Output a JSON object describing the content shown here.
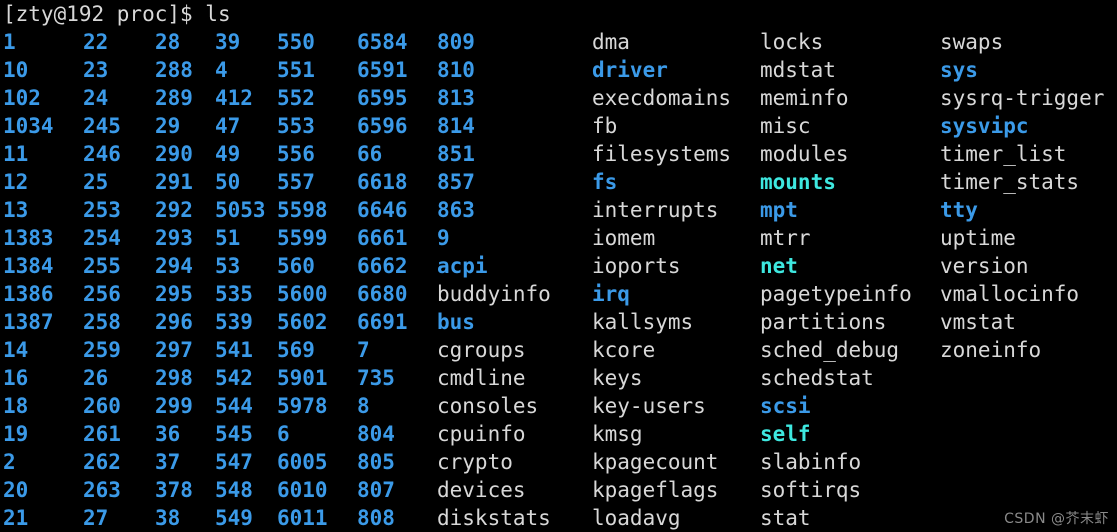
{
  "terminal": {
    "prompt": "[zty@192 proc]$ ",
    "command": "ls",
    "colors": {
      "background": "#000000",
      "file": "#d8d8d8",
      "directory": "#3b9ae8",
      "symlink": "#3ee8e0"
    }
  },
  "watermark": "CSDN @芥末虾",
  "listing": {
    "columns": [
      {
        "index": 0,
        "entries": [
          {
            "name": "1",
            "type": "dir"
          },
          {
            "name": "10",
            "type": "dir"
          },
          {
            "name": "102",
            "type": "dir"
          },
          {
            "name": "1034",
            "type": "dir"
          },
          {
            "name": "11",
            "type": "dir"
          },
          {
            "name": "12",
            "type": "dir"
          },
          {
            "name": "13",
            "type": "dir"
          },
          {
            "name": "1383",
            "type": "dir"
          },
          {
            "name": "1384",
            "type": "dir"
          },
          {
            "name": "1386",
            "type": "dir"
          },
          {
            "name": "1387",
            "type": "dir"
          },
          {
            "name": "14",
            "type": "dir"
          },
          {
            "name": "16",
            "type": "dir"
          },
          {
            "name": "18",
            "type": "dir"
          },
          {
            "name": "19",
            "type": "dir"
          },
          {
            "name": "2",
            "type": "dir"
          },
          {
            "name": "20",
            "type": "dir"
          },
          {
            "name": "21",
            "type": "dir"
          }
        ]
      },
      {
        "index": 1,
        "entries": [
          {
            "name": "22",
            "type": "dir"
          },
          {
            "name": "23",
            "type": "dir"
          },
          {
            "name": "24",
            "type": "dir"
          },
          {
            "name": "245",
            "type": "dir"
          },
          {
            "name": "246",
            "type": "dir"
          },
          {
            "name": "25",
            "type": "dir"
          },
          {
            "name": "253",
            "type": "dir"
          },
          {
            "name": "254",
            "type": "dir"
          },
          {
            "name": "255",
            "type": "dir"
          },
          {
            "name": "256",
            "type": "dir"
          },
          {
            "name": "258",
            "type": "dir"
          },
          {
            "name": "259",
            "type": "dir"
          },
          {
            "name": "26",
            "type": "dir"
          },
          {
            "name": "260",
            "type": "dir"
          },
          {
            "name": "261",
            "type": "dir"
          },
          {
            "name": "262",
            "type": "dir"
          },
          {
            "name": "263",
            "type": "dir"
          },
          {
            "name": "27",
            "type": "dir"
          }
        ]
      },
      {
        "index": 2,
        "entries": [
          {
            "name": "28",
            "type": "dir"
          },
          {
            "name": "288",
            "type": "dir"
          },
          {
            "name": "289",
            "type": "dir"
          },
          {
            "name": "29",
            "type": "dir"
          },
          {
            "name": "290",
            "type": "dir"
          },
          {
            "name": "291",
            "type": "dir"
          },
          {
            "name": "292",
            "type": "dir"
          },
          {
            "name": "293",
            "type": "dir"
          },
          {
            "name": "294",
            "type": "dir"
          },
          {
            "name": "295",
            "type": "dir"
          },
          {
            "name": "296",
            "type": "dir"
          },
          {
            "name": "297",
            "type": "dir"
          },
          {
            "name": "298",
            "type": "dir"
          },
          {
            "name": "299",
            "type": "dir"
          },
          {
            "name": "36",
            "type": "dir"
          },
          {
            "name": "37",
            "type": "dir"
          },
          {
            "name": "378",
            "type": "dir"
          },
          {
            "name": "38",
            "type": "dir"
          }
        ]
      },
      {
        "index": 3,
        "entries": [
          {
            "name": "39",
            "type": "dir"
          },
          {
            "name": "4",
            "type": "dir"
          },
          {
            "name": "412",
            "type": "dir"
          },
          {
            "name": "47",
            "type": "dir"
          },
          {
            "name": "49",
            "type": "dir"
          },
          {
            "name": "50",
            "type": "dir"
          },
          {
            "name": "5053",
            "type": "dir"
          },
          {
            "name": "51",
            "type": "dir"
          },
          {
            "name": "53",
            "type": "dir"
          },
          {
            "name": "535",
            "type": "dir"
          },
          {
            "name": "539",
            "type": "dir"
          },
          {
            "name": "541",
            "type": "dir"
          },
          {
            "name": "542",
            "type": "dir"
          },
          {
            "name": "544",
            "type": "dir"
          },
          {
            "name": "545",
            "type": "dir"
          },
          {
            "name": "547",
            "type": "dir"
          },
          {
            "name": "548",
            "type": "dir"
          },
          {
            "name": "549",
            "type": "dir"
          }
        ]
      },
      {
        "index": 4,
        "entries": [
          {
            "name": "550",
            "type": "dir"
          },
          {
            "name": "551",
            "type": "dir"
          },
          {
            "name": "552",
            "type": "dir"
          },
          {
            "name": "553",
            "type": "dir"
          },
          {
            "name": "556",
            "type": "dir"
          },
          {
            "name": "557",
            "type": "dir"
          },
          {
            "name": "5598",
            "type": "dir"
          },
          {
            "name": "5599",
            "type": "dir"
          },
          {
            "name": "560",
            "type": "dir"
          },
          {
            "name": "5600",
            "type": "dir"
          },
          {
            "name": "5602",
            "type": "dir"
          },
          {
            "name": "569",
            "type": "dir"
          },
          {
            "name": "5901",
            "type": "dir"
          },
          {
            "name": "5978",
            "type": "dir"
          },
          {
            "name": "6",
            "type": "dir"
          },
          {
            "name": "6005",
            "type": "dir"
          },
          {
            "name": "6010",
            "type": "dir"
          },
          {
            "name": "6011",
            "type": "dir"
          }
        ]
      },
      {
        "index": 5,
        "entries": [
          {
            "name": "6584",
            "type": "dir"
          },
          {
            "name": "6591",
            "type": "dir"
          },
          {
            "name": "6595",
            "type": "dir"
          },
          {
            "name": "6596",
            "type": "dir"
          },
          {
            "name": "66",
            "type": "dir"
          },
          {
            "name": "6618",
            "type": "dir"
          },
          {
            "name": "6646",
            "type": "dir"
          },
          {
            "name": "6661",
            "type": "dir"
          },
          {
            "name": "6662",
            "type": "dir"
          },
          {
            "name": "6680",
            "type": "dir"
          },
          {
            "name": "6691",
            "type": "dir"
          },
          {
            "name": "7",
            "type": "dir"
          },
          {
            "name": "735",
            "type": "dir"
          },
          {
            "name": "8",
            "type": "dir"
          },
          {
            "name": "804",
            "type": "dir"
          },
          {
            "name": "805",
            "type": "dir"
          },
          {
            "name": "807",
            "type": "dir"
          },
          {
            "name": "808",
            "type": "dir"
          }
        ]
      },
      {
        "index": 6,
        "entries": [
          {
            "name": "809",
            "type": "dir"
          },
          {
            "name": "810",
            "type": "dir"
          },
          {
            "name": "813",
            "type": "dir"
          },
          {
            "name": "814",
            "type": "dir"
          },
          {
            "name": "851",
            "type": "dir"
          },
          {
            "name": "857",
            "type": "dir"
          },
          {
            "name": "863",
            "type": "dir"
          },
          {
            "name": "9",
            "type": "dir"
          },
          {
            "name": "acpi",
            "type": "dir"
          },
          {
            "name": "buddyinfo",
            "type": "file"
          },
          {
            "name": "bus",
            "type": "dir"
          },
          {
            "name": "cgroups",
            "type": "file"
          },
          {
            "name": "cmdline",
            "type": "file"
          },
          {
            "name": "consoles",
            "type": "file"
          },
          {
            "name": "cpuinfo",
            "type": "file"
          },
          {
            "name": "crypto",
            "type": "file"
          },
          {
            "name": "devices",
            "type": "file"
          },
          {
            "name": "diskstats",
            "type": "file"
          }
        ]
      },
      {
        "index": 7,
        "entries": [
          {
            "name": "dma",
            "type": "file"
          },
          {
            "name": "driver",
            "type": "dir"
          },
          {
            "name": "execdomains",
            "type": "file"
          },
          {
            "name": "fb",
            "type": "file"
          },
          {
            "name": "filesystems",
            "type": "file"
          },
          {
            "name": "fs",
            "type": "dir"
          },
          {
            "name": "interrupts",
            "type": "file"
          },
          {
            "name": "iomem",
            "type": "file"
          },
          {
            "name": "ioports",
            "type": "file"
          },
          {
            "name": "irq",
            "type": "dir"
          },
          {
            "name": "kallsyms",
            "type": "file"
          },
          {
            "name": "kcore",
            "type": "file"
          },
          {
            "name": "keys",
            "type": "file"
          },
          {
            "name": "key-users",
            "type": "file"
          },
          {
            "name": "kmsg",
            "type": "file"
          },
          {
            "name": "kpagecount",
            "type": "file"
          },
          {
            "name": "kpageflags",
            "type": "file"
          },
          {
            "name": "loadavg",
            "type": "file"
          }
        ]
      },
      {
        "index": 8,
        "entries": [
          {
            "name": "locks",
            "type": "file"
          },
          {
            "name": "mdstat",
            "type": "file"
          },
          {
            "name": "meminfo",
            "type": "file"
          },
          {
            "name": "misc",
            "type": "file"
          },
          {
            "name": "modules",
            "type": "file"
          },
          {
            "name": "mounts",
            "type": "link"
          },
          {
            "name": "mpt",
            "type": "dir"
          },
          {
            "name": "mtrr",
            "type": "file"
          },
          {
            "name": "net",
            "type": "link"
          },
          {
            "name": "pagetypeinfo",
            "type": "file"
          },
          {
            "name": "partitions",
            "type": "file"
          },
          {
            "name": "sched_debug",
            "type": "file"
          },
          {
            "name": "schedstat",
            "type": "file"
          },
          {
            "name": "scsi",
            "type": "dir"
          },
          {
            "name": "self",
            "type": "link"
          },
          {
            "name": "slabinfo",
            "type": "file"
          },
          {
            "name": "softirqs",
            "type": "file"
          },
          {
            "name": "stat",
            "type": "file"
          }
        ]
      },
      {
        "index": 9,
        "entries": [
          {
            "name": "swaps",
            "type": "file"
          },
          {
            "name": "sys",
            "type": "dir"
          },
          {
            "name": "sysrq-trigger",
            "type": "file"
          },
          {
            "name": "sysvipc",
            "type": "dir"
          },
          {
            "name": "timer_list",
            "type": "file"
          },
          {
            "name": "timer_stats",
            "type": "file"
          },
          {
            "name": "tty",
            "type": "dir"
          },
          {
            "name": "uptime",
            "type": "file"
          },
          {
            "name": "version",
            "type": "file"
          },
          {
            "name": "vmallocinfo",
            "type": "file"
          },
          {
            "name": "vmstat",
            "type": "file"
          },
          {
            "name": "zoneinfo",
            "type": "file"
          }
        ]
      }
    ]
  }
}
